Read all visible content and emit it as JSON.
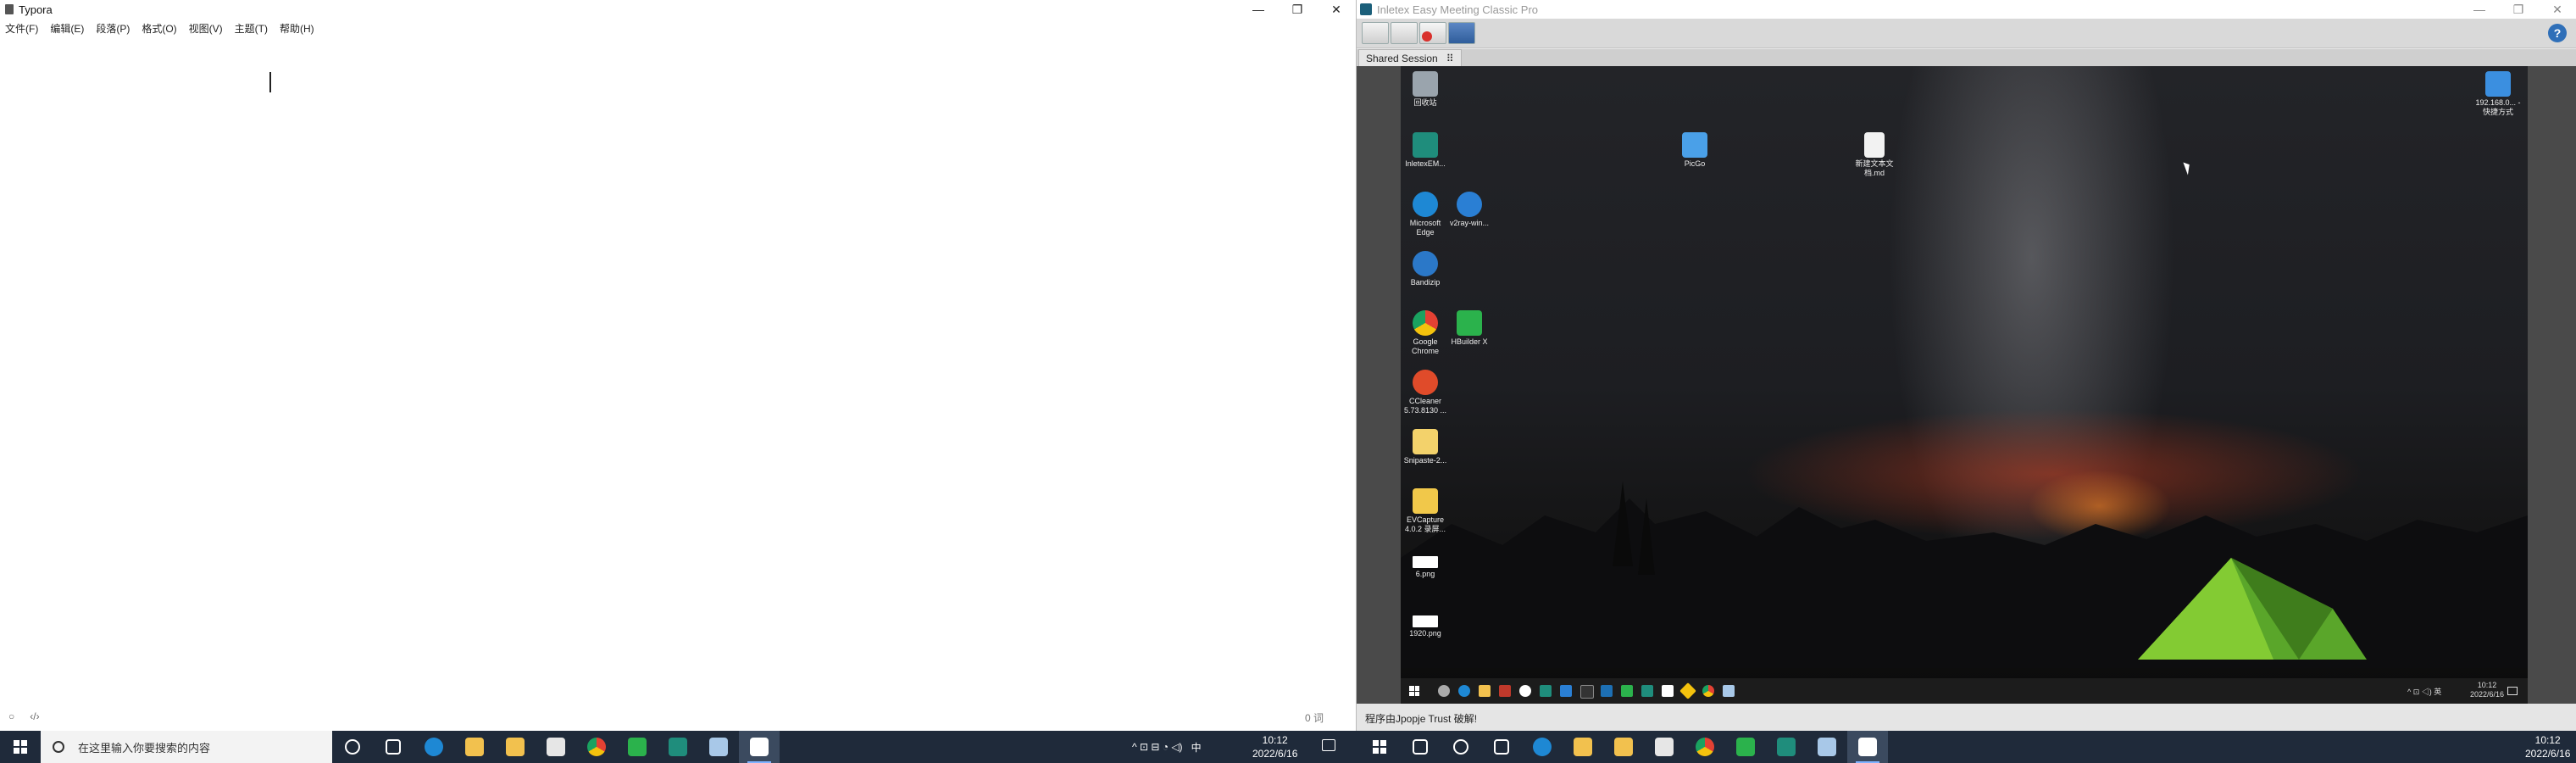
{
  "typora": {
    "title": "Typora",
    "menu": [
      "文件(F)",
      "编辑(E)",
      "段落(P)",
      "格式(O)",
      "视图(V)",
      "主题(T)",
      "帮助(H)"
    ],
    "status_icons": [
      "○",
      "‹/›"
    ],
    "wordcount": "0 词",
    "window_buttons": [
      "—",
      "❐",
      "✕"
    ]
  },
  "meeting": {
    "title": "Inletex Easy Meeting Classic Pro",
    "window_buttons": [
      "—",
      "❐",
      "✕"
    ],
    "session_tab": "Shared Session",
    "session_tab_pin": "⠿",
    "help_label": "?",
    "status_text": "程序由Jpopje Trust 破解!",
    "remote_desktop": {
      "icons": [
        {
          "label": "回收站",
          "color": "#9aa4ad"
        },
        {
          "label": "InletexEM...",
          "color": "#1f8d7c"
        },
        {
          "label": "Microsoft Edge",
          "color": "#1e88d4"
        },
        {
          "label": "v2ray-win...",
          "color": "#2a7fd4"
        },
        {
          "label": "Bandizip",
          "color": "#2b78c8"
        },
        {
          "label": "Google Chrome",
          "color": "#e44133"
        },
        {
          "label": "HBuilder X",
          "color": "#2bb24c"
        },
        {
          "label": "CCleaner 5.73.8130 ...",
          "color": "#e04b2a"
        },
        {
          "label": "Snipaste-2...",
          "color": "#f3d26b"
        },
        {
          "label": "EVCapture 4.0.2 录屏...",
          "color": "#f1c84a"
        },
        {
          "label": "6.png",
          "color": "#ffffff"
        },
        {
          "label": "1920.png",
          "color": "#ffffff"
        },
        {
          "label": "PicGo",
          "color": "#4aa0e8"
        },
        {
          "label": "新建文本文档.md",
          "color": "#f2f2f2"
        },
        {
          "label": "192.168.0... - 快捷方式",
          "color": "#3b8fe0"
        }
      ],
      "taskbar_clock": {
        "time": "10:12",
        "date": "2022/6/16"
      },
      "tray_text": "^ ⊡ ◁) 英"
    }
  },
  "taskbar": {
    "search_placeholder": "在这里输入你要搜索的内容",
    "apps_left": [
      {
        "name": "cortana",
        "color": "#ffffff"
      },
      {
        "name": "task-view",
        "color": "#ffffff"
      },
      {
        "name": "edge",
        "color": "#1e88d4"
      },
      {
        "name": "file-explorer",
        "color": "#f2c14e"
      },
      {
        "name": "store",
        "color": "#f2c14e"
      },
      {
        "name": "mail",
        "color": "#e6e6e6"
      },
      {
        "name": "chrome",
        "color": "#e44133"
      },
      {
        "name": "hbuilder",
        "color": "#2bb24c"
      },
      {
        "name": "inletex",
        "color": "#1f8d7c"
      },
      {
        "name": "snipaste",
        "color": "#a8c8e8"
      },
      {
        "name": "typora",
        "color": "#ffffff"
      }
    ],
    "apps_right": [
      {
        "name": "search",
        "color": "#ffffff"
      },
      {
        "name": "cortana",
        "color": "#ffffff"
      },
      {
        "name": "task-view",
        "color": "#ffffff"
      },
      {
        "name": "edge",
        "color": "#1e88d4"
      },
      {
        "name": "file-explorer",
        "color": "#f2c14e"
      },
      {
        "name": "store",
        "color": "#f2c14e"
      },
      {
        "name": "mail",
        "color": "#e6e6e6"
      },
      {
        "name": "chrome",
        "color": "#e44133"
      },
      {
        "name": "hbuilder",
        "color": "#2bb24c"
      },
      {
        "name": "inletex",
        "color": "#1f8d7c"
      },
      {
        "name": "snipaste",
        "color": "#a8c8e8"
      },
      {
        "name": "typora",
        "color": "#ffffff"
      }
    ],
    "tray_left": {
      "ime": "中",
      "extra": "^ ⊡ ⊟ ◔ ◁)"
    },
    "clock_left": {
      "time": "10:12",
      "date": "2022/6/16"
    },
    "clock_right": {
      "time": "10:12",
      "date": "2022/6/16"
    }
  }
}
